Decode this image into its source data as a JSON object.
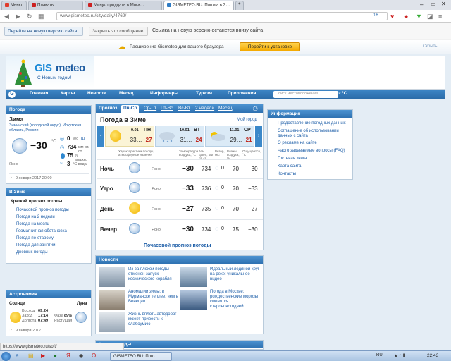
{
  "browser": {
    "tabs": [
      {
        "label": "Меню"
      },
      {
        "label": "Плакать"
      },
      {
        "label": "Минус придцать в Моск…"
      },
      {
        "label": "GISMETEO.RU: Погода в З…"
      }
    ],
    "url": "www.gismeteo.ru/city/daily/4769/",
    "ext_count": "16"
  },
  "notice": {
    "new_version_btn": "Перейти на новую версию сайта",
    "close_btn": "Закрыть это сообщение",
    "text": "Ссылка на новую версию останется внизу сайта"
  },
  "ext_banner": {
    "text": "Расширение Gismeteo для вашего браузера",
    "install_btn": "Перейти к установке",
    "hide": "Скрыть"
  },
  "logo": {
    "brand_gis": "GIS",
    "brand_meteo": "meteo",
    "tagline": "С Новым годом!"
  },
  "nav": {
    "items": [
      "Главная",
      "Карты",
      "Новости",
      "Месяц",
      "Информеры",
      "Туризм",
      "Приложения"
    ],
    "search_placeholder": "Поиск местоположения",
    "unit": "°C"
  },
  "left_weather": {
    "title": "Погода",
    "city": "Зима",
    "region": "Зиминский (городской округ), Иркутская область, Россия",
    "temp": "−30",
    "unit": "°C",
    "wind": "0",
    "wind_unit": "м/с",
    "wind_dir": "Ш",
    "pressure": "734",
    "pressure_unit": "мм рт. ст",
    "humidity": "75",
    "humidity_unit": "% влажн.",
    "water": "3",
    "water_unit": "°C вода",
    "cond": "Ясно",
    "time": "9 января 2017 20:00"
  },
  "in_city": {
    "title": "В Зиме",
    "links": [
      "Краткий прогноз погоды",
      "Почасовой прогноз погоды",
      "Погода на 2 недели",
      "Погода на месяц",
      "Геомагнитная обстановка",
      "Погода по-старому",
      "Погода для занятий",
      "Дневник погоды"
    ]
  },
  "astro": {
    "title": "Астрономия",
    "sun_label": "Солнце",
    "moon_label": "Луна",
    "rise_label": "Восход",
    "rise": "09:24",
    "set_label": "Заход",
    "set": "17:14",
    "len_label": "Долгота",
    "len": "07:49",
    "phase_label": "Фаза",
    "phase": "89%",
    "trend": "Растущая",
    "date": "9 января 2017"
  },
  "forecast": {
    "tabs": [
      "Прогноз",
      "Пн-Ср",
      "Ср-Пт",
      "Пт-Вс",
      "Вс-Вт",
      "2 недели",
      "Месяц"
    ],
    "print_icon_title": "Печать",
    "title": "Погода в Зиме",
    "my_weather": "Мой город",
    "days": [
      {
        "date": "9.01",
        "dow": "ПН",
        "tmin": "−33…",
        "tmax": "−27"
      },
      {
        "date": "10.01",
        "dow": "ВТ",
        "tmin": "−31…",
        "tmax": "−24"
      },
      {
        "date": "11.01",
        "dow": "СР",
        "tmin": "−29…",
        "tmax": "−21"
      }
    ],
    "col_headers": [
      "Характеристики погоды, атмосферные явления",
      "Температура воздуха, °C",
      "Атм. давл., мм рт. ст.",
      "Ветер, м/с",
      "Влажн. воздуха, %",
      "Ощущается, °C"
    ],
    "rows": [
      {
        "period": "Ночь",
        "cond": "Ясно",
        "temp": "−30",
        "pressure": "734",
        "wind": "0",
        "humidity": "70",
        "feels": "−30"
      },
      {
        "period": "Утро",
        "cond": "Ясно",
        "temp": "−33",
        "pressure": "736",
        "wind": "0",
        "humidity": "70",
        "feels": "−33"
      },
      {
        "period": "День",
        "cond": "Ясно",
        "temp": "−27",
        "pressure": "735",
        "wind": "0",
        "humidity": "70",
        "feels": "−27"
      },
      {
        "period": "Вечер",
        "cond": "Ясно",
        "temp": "−30",
        "pressure": "734",
        "wind": "0",
        "humidity": "75",
        "feels": "−30"
      }
    ],
    "hourly_link": "Почасовой прогноз погоды"
  },
  "info": {
    "title": "Информация",
    "links": [
      "Предоставление погодных данных",
      "Соглашение об использовании данных с сайта",
      "О рекламе на сайте",
      "Часто задаваемые вопросы (FAQ)",
      "Гостевая книга",
      "Карта сайта",
      "Контакты"
    ]
  },
  "news": {
    "title": "Новости",
    "items": [
      "Из-за плохой погоды отменен запуск космического корабля",
      "Идеальный ледяной круг на реке: уникальное видео",
      "Аномалии зимы: в Мурманске теплее, чем в Венеции",
      "Погода в Москве: рождественские морозы сменятся староновогодней",
      "Жизнь вплоть автодорог может привести к слабоумию"
    ]
  },
  "maps": {
    "title": "Карты погоды"
  },
  "statusbar": {
    "url": "https://www.gismeteo.ru/soft/"
  },
  "taskbar": {
    "app": "GISMETEO.RU: Пого…",
    "lang": "RU",
    "clock": "22:43"
  }
}
